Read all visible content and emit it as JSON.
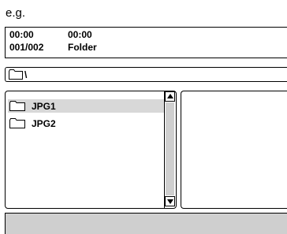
{
  "caption": "e.g.",
  "status": {
    "elapsed_time": "00:00",
    "total_time": "00:00",
    "track_counter": "001/002",
    "current_type": "Folder"
  },
  "path": {
    "icon": "folder-icon",
    "text": "\\"
  },
  "file_list": {
    "items": [
      {
        "label": "JPG1",
        "icon": "folder-icon",
        "selected": true
      },
      {
        "label": "JPG2",
        "icon": "folder-icon",
        "selected": false
      }
    ],
    "scrollbar": {
      "up_icon": "arrow-up-icon",
      "down_icon": "arrow-down-icon"
    }
  },
  "colors": {
    "selection": "#d8d8d8",
    "bottom_bar": "#cfcfcf"
  }
}
